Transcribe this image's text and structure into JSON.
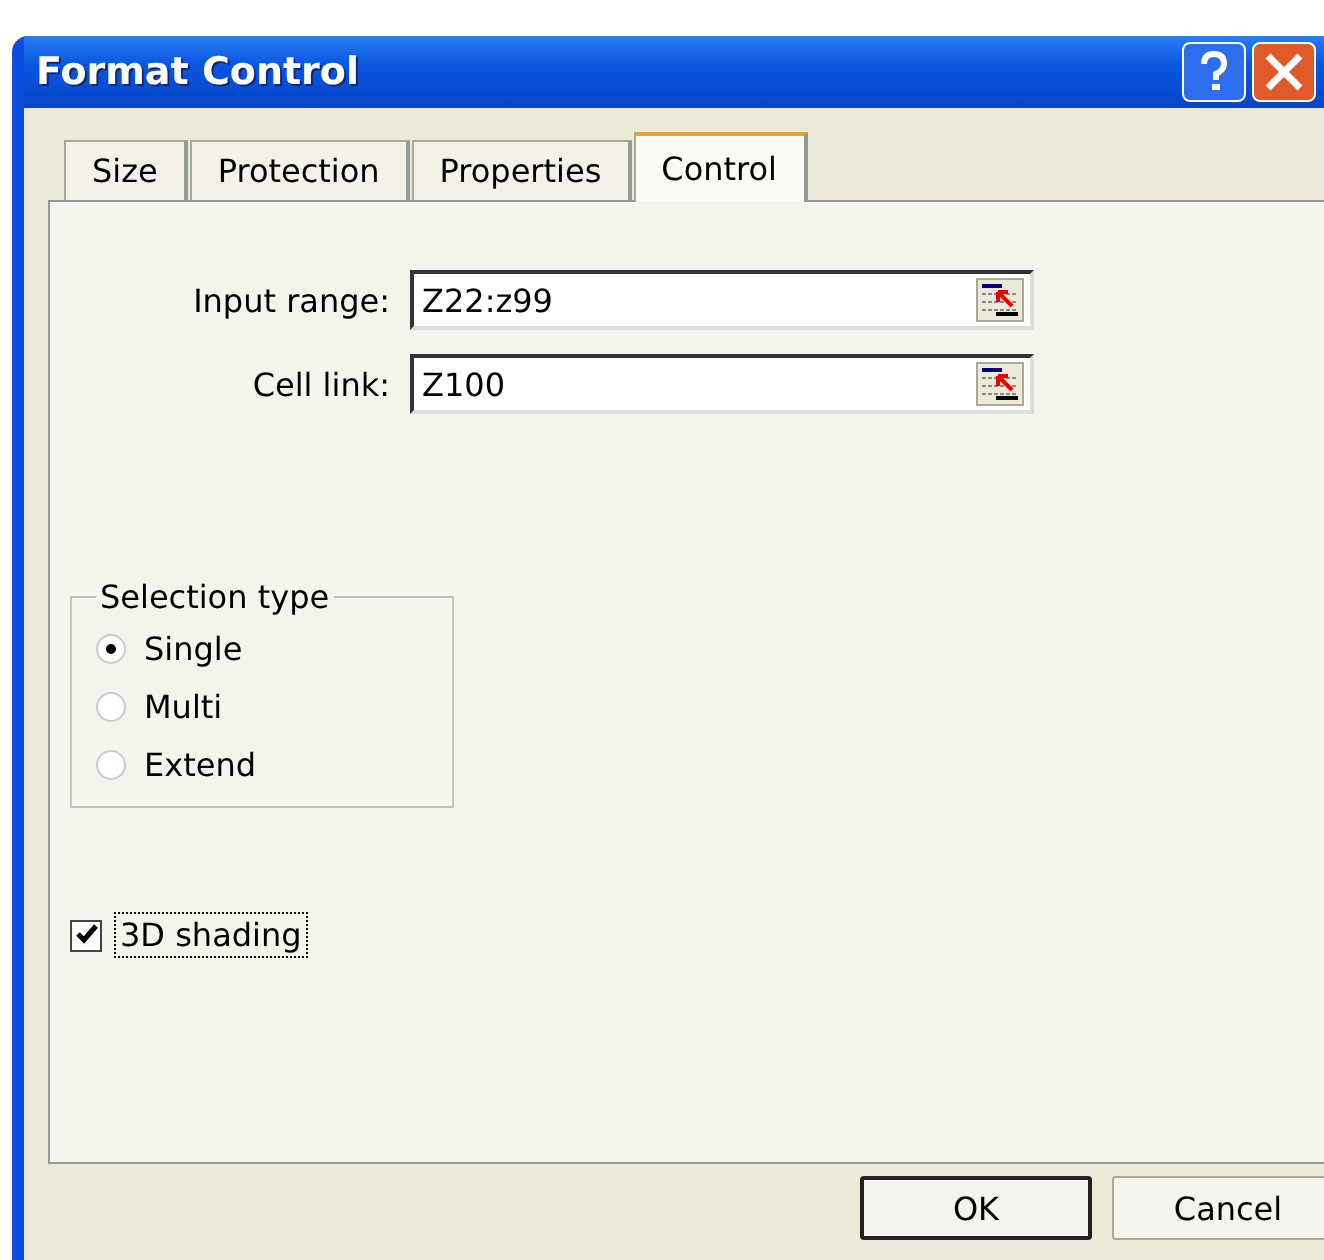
{
  "window": {
    "title": "Format Control"
  },
  "tabs": [
    {
      "label": "Size",
      "selected": false
    },
    {
      "label": "Protection",
      "selected": false
    },
    {
      "label": "Properties",
      "selected": false
    },
    {
      "label": "Control",
      "selected": true
    }
  ],
  "fields": [
    {
      "label": "Input range:",
      "value": "Z22:z99"
    },
    {
      "label": "Cell link:",
      "value": "Z100"
    }
  ],
  "selection_type": {
    "title": "Selection type",
    "options": [
      {
        "label": "Single",
        "selected": true
      },
      {
        "label": "Multi",
        "selected": false
      },
      {
        "label": "Extend",
        "selected": false
      }
    ]
  },
  "shading": {
    "label": "3D shading",
    "checked": true
  },
  "buttons": [
    {
      "label": "OK",
      "default": true
    },
    {
      "label": "Cancel",
      "default": false
    }
  ]
}
